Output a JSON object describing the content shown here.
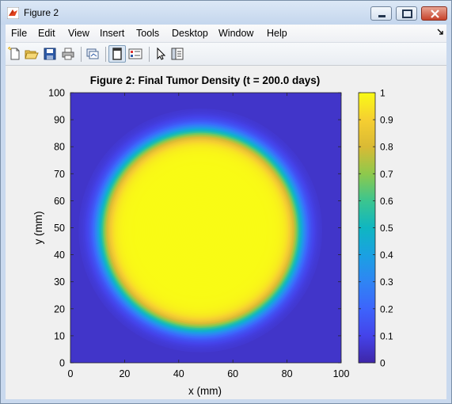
{
  "window": {
    "title": "Figure 2"
  },
  "menu": [
    "File",
    "Edit",
    "View",
    "Insert",
    "Tools",
    "Desktop",
    "Window",
    "Help"
  ],
  "toolbar": {
    "buttons": [
      "new-figure",
      "open-file",
      "save",
      "print",
      "link-plot",
      "dock",
      "insert-colorbar",
      "edit-plot",
      "property-inspector"
    ]
  },
  "plot": {
    "title": "Figure 2: Final Tumor Density (t = 200.0 days)",
    "xlabel": "x (mm)",
    "ylabel": "y (mm)",
    "x_ticks": [
      "0",
      "20",
      "40",
      "60",
      "80",
      "100"
    ],
    "y_ticks": [
      "0",
      "10",
      "20",
      "30",
      "40",
      "50",
      "60",
      "70",
      "80",
      "90",
      "100"
    ],
    "colorbar_ticks": [
      "0",
      "0.1",
      "0.2",
      "0.3",
      "0.4",
      "0.5",
      "0.6",
      "0.7",
      "0.8",
      "0.9",
      "1"
    ]
  },
  "chart_data": {
    "type": "heatmap",
    "title": "Figure 2: Final Tumor Density (t = 200.0 days)",
    "xlabel": "x (mm)",
    "ylabel": "y (mm)",
    "xlim": [
      0,
      100
    ],
    "ylim": [
      0,
      100
    ],
    "clim": [
      0,
      1
    ],
    "colormap": "parula",
    "description_of_field": "circular region of high density",
    "center": [
      48,
      49
    ],
    "plateau_value": 1.0,
    "plateau_radius": 33,
    "edge_half_value_radius": 37,
    "edge_width": 4,
    "background_value": 0.05,
    "colors": {
      "low": "#3e26a8",
      "high": "#f9fb15",
      "mid": "#21b8bd"
    }
  }
}
